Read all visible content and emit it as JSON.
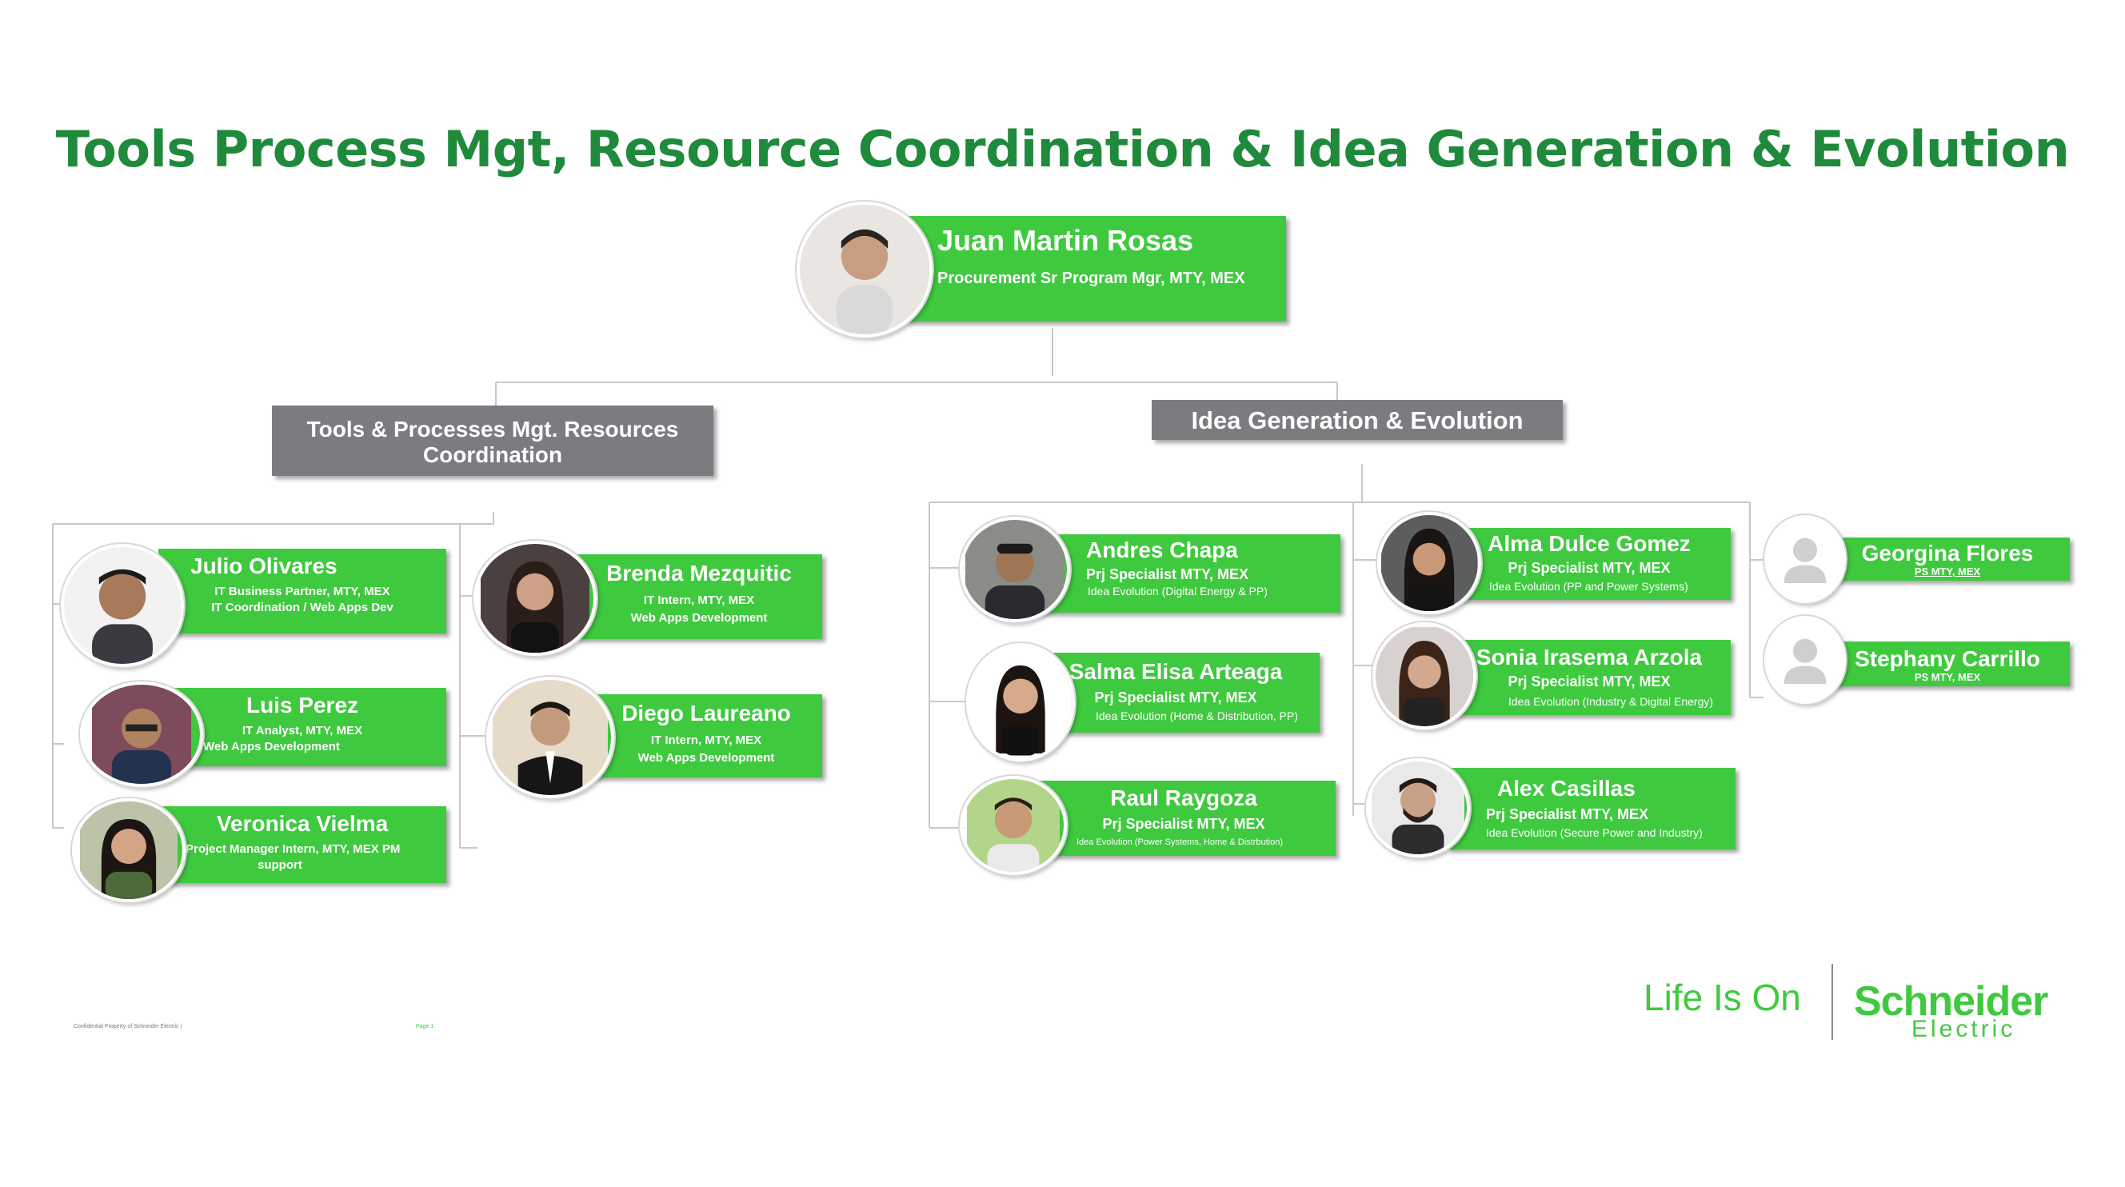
{
  "title": "Tools Process Mgt, Resource Coordination & Idea Generation & Evolution",
  "manager": {
    "name": "Juan Martin Rosas",
    "role": "Procurement Sr Program Mgr, MTY, MEX"
  },
  "groups": {
    "left": "Tools & Processes Mgt. Resources Coordination",
    "right": "Idea Generation & Evolution"
  },
  "people": {
    "julio": {
      "name": "Julio Olivares",
      "role": "IT Business Partner, MTY, MEX",
      "sub": "IT Coordination / Web Apps Dev"
    },
    "luis": {
      "name": "Luis Perez",
      "role": "IT Analyst, MTY, MEX",
      "sub": "Web Apps Development"
    },
    "veronica": {
      "name": "Veronica Vielma",
      "role": "Project Manager Intern, MTY, MEX PM",
      "sub": "support"
    },
    "brenda": {
      "name": "Brenda Mezquitic",
      "role": "IT Intern, MTY, MEX",
      "sub": "Web Apps Development"
    },
    "diego": {
      "name": "Diego Laureano",
      "role": "IT Intern, MTY, MEX",
      "sub": "Web Apps Development"
    },
    "andres": {
      "name": "Andres Chapa",
      "role": "Prj Specialist MTY, MEX",
      "sub": "Idea Evolution (Digital Energy & PP)"
    },
    "salma": {
      "name": "Salma Elisa Arteaga",
      "role": "Prj Specialist MTY, MEX",
      "sub": "Idea Evolution (Home & Distribution, PP)"
    },
    "raul": {
      "name": "Raul Raygoza",
      "role": "Prj Specialist MTY, MEX",
      "sub": "Idea Evolution (Power Systems, Home & Distrbution)"
    },
    "alma": {
      "name": "Alma Dulce Gomez",
      "role": "Prj Specialist MTY, MEX",
      "sub": "Idea Evolution (PP and Power Systems)"
    },
    "sonia": {
      "name": "Sonia Irasema Arzola",
      "role": "Prj Specialist MTY, MEX",
      "sub": "Idea Evolution (Industry & Digital Energy)"
    },
    "alex": {
      "name": "Alex Casillas",
      "role": "Prj Specialist MTY, MEX",
      "sub": "Idea Evolution (Secure Power and Industry)"
    },
    "georgina": {
      "name": "Georgina Flores",
      "role": "PS MTY, MEX"
    },
    "stephany": {
      "name": "Stephany Carrillo",
      "role": "PS MTY, MEX"
    }
  },
  "footer": {
    "confidential": "Confidential Property of Schneider Electric |",
    "page": "Page 1"
  },
  "logo": {
    "tagline": "Life Is On",
    "brand_top": "Schneider",
    "brand_bottom": "Electric"
  },
  "colors": {
    "title": "#1f8a3c",
    "card": "#3fc93f",
    "group": "#7b7b80",
    "connector": "#c8c8c8"
  }
}
